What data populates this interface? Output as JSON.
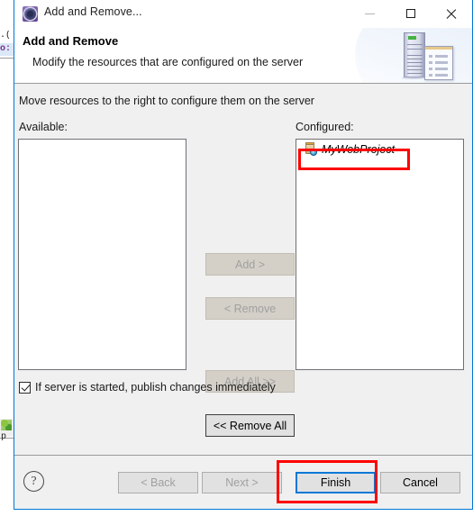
{
  "window": {
    "title": "Add and Remove...",
    "icon": "eclipse-server-icon",
    "controls": {
      "minimize": "minimize-icon",
      "maximize": "maximize-icon",
      "close": "close-icon"
    }
  },
  "banner": {
    "title": "Add and Remove",
    "subtitle": "Modify the resources that are configured on the server",
    "artwork": "server-and-document-icon"
  },
  "body": {
    "instruction": "Move resources to the right to configure them on the server",
    "available": {
      "label": "Available:",
      "items": []
    },
    "configured": {
      "label": "Configured:",
      "items": [
        {
          "name": "MyWebProject",
          "icon": "web-module-icon"
        }
      ]
    },
    "transfer_buttons": [
      {
        "label": "Add >",
        "enabled": false
      },
      {
        "label": "< Remove",
        "enabled": false
      },
      {
        "label": "Add All >>",
        "enabled": false
      },
      {
        "label": "<< Remove All",
        "enabled": true
      }
    ],
    "publish_option": {
      "label": "If server is started, publish changes immediately",
      "checked": true
    }
  },
  "footer": {
    "help": "?",
    "buttons": [
      {
        "label": "< Back",
        "enabled": false,
        "focused": false
      },
      {
        "label": "Next >",
        "enabled": false,
        "focused": false
      },
      {
        "label": "Finish",
        "enabled": true,
        "focused": true
      },
      {
        "label": "Cancel",
        "enabled": true,
        "focused": false
      }
    ]
  },
  "annotations": {
    "color": "#ff0000",
    "targets": [
      "configured-item-MyWebProject",
      "finish-button"
    ]
  },
  "backdrop": {
    "line1": ".(",
    "line2": "o:",
    "tab_label": "p"
  }
}
